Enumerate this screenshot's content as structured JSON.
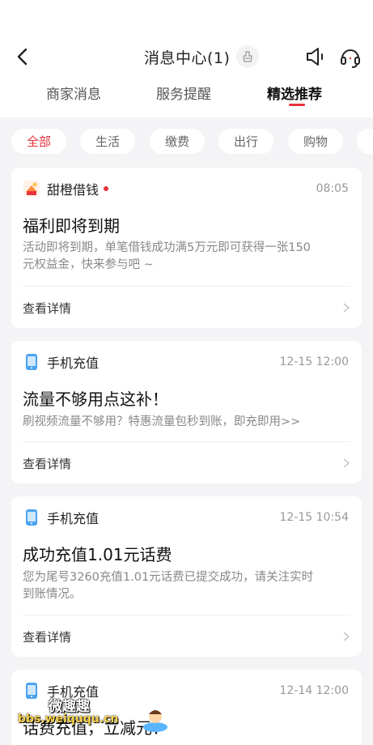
{
  "header": {
    "title": "消息中心(1)",
    "back_icon": "chevron-left-icon",
    "clean_icon": "broom-icon",
    "speaker_icon": "speaker-icon",
    "service_icon": "headset-icon"
  },
  "tabs": [
    {
      "label": "商家消息",
      "active": false
    },
    {
      "label": "服务提醒",
      "active": false
    },
    {
      "label": "精选推荐",
      "active": true
    }
  ],
  "filters": [
    {
      "label": "全部",
      "active": true
    },
    {
      "label": "生活",
      "active": false
    },
    {
      "label": "缴费",
      "active": false
    },
    {
      "label": "出行",
      "active": false
    },
    {
      "label": "购物",
      "active": false
    }
  ],
  "colors": {
    "accent": "#e8333b",
    "background": "#f4f4f6"
  },
  "messages": [
    {
      "app": "甜橙借钱",
      "icon": "sweet-orange-loan-icon",
      "unread": true,
      "time": "08:05",
      "title": "福利即将到期",
      "body_lines": [
        "活动即将到期，单笔借钱成功满5万元即可获得一张150",
        "元权益金，快来参与吧 ~"
      ],
      "detail_label": "查看详情"
    },
    {
      "app": "手机充值",
      "icon": "phone-recharge-icon",
      "unread": false,
      "time": "12-15 12:00",
      "title": "流量不够用点这补！",
      "body_lines": [
        "刷视频流量不够用？特惠流量包秒到账，即充即用>>"
      ],
      "detail_label": "查看详情"
    },
    {
      "app": "手机充值",
      "icon": "phone-recharge-icon",
      "unread": false,
      "time": "12-15 10:54",
      "title": "成功充值1.01元话费",
      "body_lines": [
        "您为尾号3260充值1.01元话费已提交成功，请关注实时",
        "到账情况。"
      ],
      "detail_label": "查看详情"
    },
    {
      "app": "手机充值",
      "icon": "phone-recharge-icon",
      "unread": false,
      "time": "12-14 12:00",
      "title": "话费充值，立减元！",
      "body_lines": [],
      "detail_label": ""
    }
  ],
  "watermark": {
    "name": "微趣趣",
    "url": "bbs.weiququ.cn"
  }
}
